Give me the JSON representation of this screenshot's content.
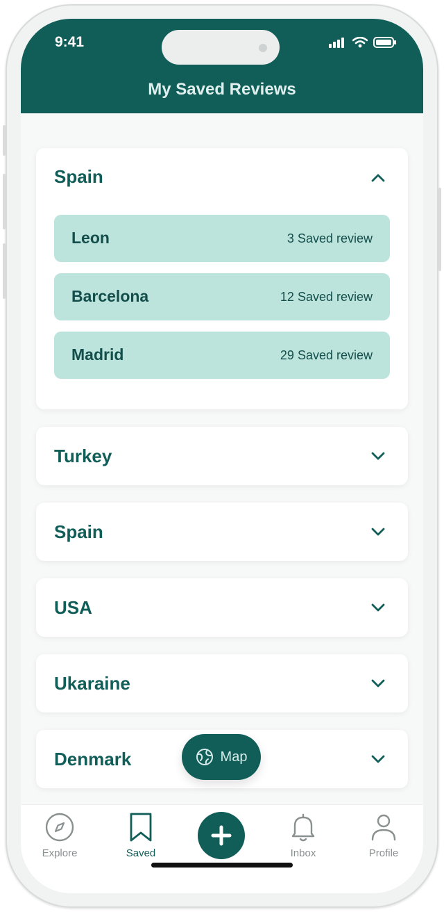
{
  "status_bar": {
    "time": "9:41"
  },
  "header": {
    "title": "My Saved Reviews"
  },
  "expanded_country": {
    "name": "Spain",
    "cities": [
      {
        "name": "Leon",
        "count": "3 Saved review"
      },
      {
        "name": "Barcelona",
        "count": "12 Saved review"
      },
      {
        "name": "Madrid",
        "count": "29 Saved review"
      }
    ]
  },
  "collapsed_countries": [
    {
      "name": "Turkey"
    },
    {
      "name": "Spain"
    },
    {
      "name": "USA"
    },
    {
      "name": "Ukaraine"
    },
    {
      "name": "Denmark"
    }
  ],
  "map_button": {
    "label": "Map",
    "icon": "globe-icon"
  },
  "tabbar": {
    "items": [
      {
        "label": "Explore",
        "icon": "compass-icon"
      },
      {
        "label": "Saved",
        "icon": "bookmark-icon"
      },
      {
        "label": "",
        "icon": "plus-icon"
      },
      {
        "label": "Inbox",
        "icon": "bell-icon"
      },
      {
        "label": "Profile",
        "icon": "user-icon"
      }
    ],
    "active": "Saved"
  },
  "colors": {
    "primary": "#115e59",
    "city_bg": "#bde3dd",
    "city_text": "#134e4a"
  }
}
